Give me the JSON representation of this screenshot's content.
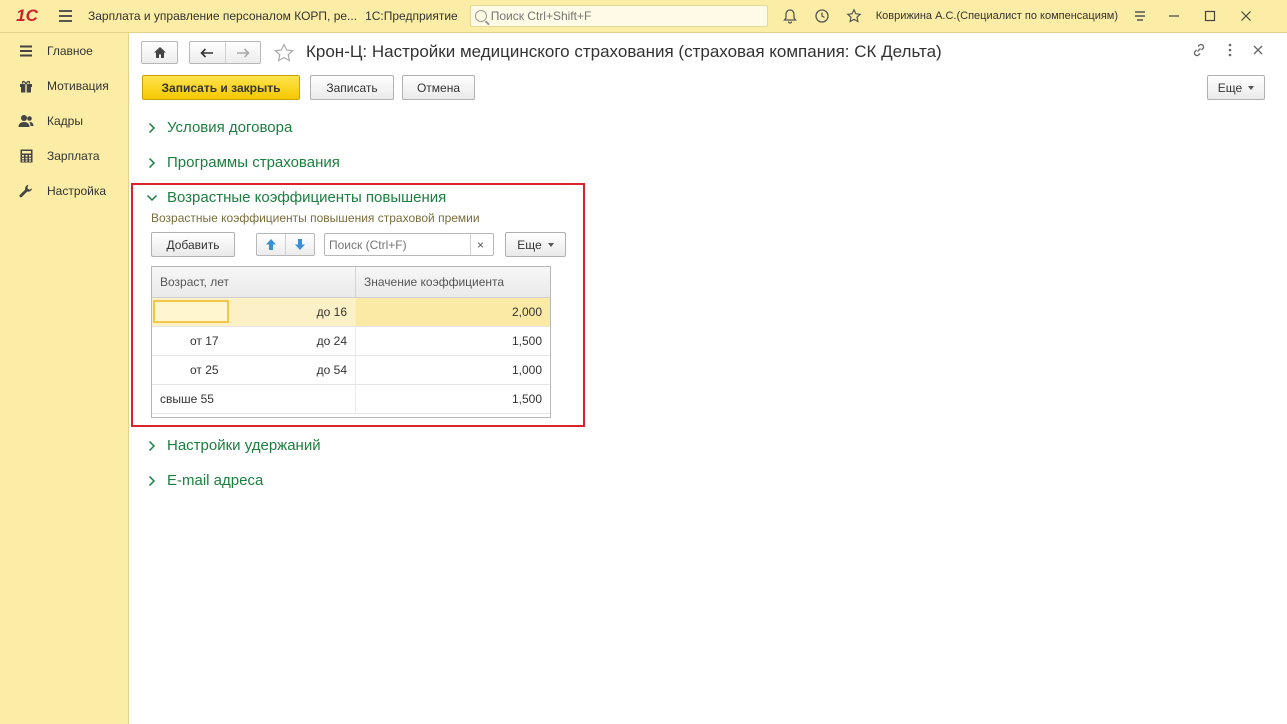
{
  "titlebar": {
    "logo": "1С",
    "app_title": "Зарплата и управление персоналом КОРП, ре...",
    "platform": "1С:Предприятие",
    "search_placeholder": "Поиск Ctrl+Shift+F",
    "user": "Коврижина А.С.(Специалист по компенсациям)"
  },
  "sidebar": {
    "items": [
      {
        "label": "Главное",
        "icon": "menu-lines-icon"
      },
      {
        "label": "Мотивация",
        "icon": "gift-icon"
      },
      {
        "label": "Кадры",
        "icon": "people-icon"
      },
      {
        "label": "Зарплата",
        "icon": "calculator-icon"
      },
      {
        "label": "Настройка",
        "icon": "wrench-icon"
      }
    ]
  },
  "document": {
    "title": "Крон-Ц: Настройки медицинского страхования (страховая компания: СК Дельта)"
  },
  "toolbar": {
    "save_close": "Записать и закрыть",
    "save": "Записать",
    "cancel": "Отмена",
    "more": "Еще"
  },
  "sections": {
    "contract": "Условия договора",
    "programs": "Программы страхования",
    "age_coef": "Возрастные коэффициенты повышения",
    "deductions": "Настройки удержаний",
    "email": "E-mail адреса"
  },
  "age_table": {
    "caption": "Возрастные коэффициенты повышения страховой премии",
    "add": "Добавить",
    "search_placeholder": "Поиск (Ctrl+F)",
    "clear": "×",
    "more": "Еще",
    "headers": {
      "age": "Возраст, лет",
      "value": "Значение коэффициента"
    },
    "rows": [
      {
        "from": "",
        "to": "до 16",
        "value": "2,000"
      },
      {
        "from": "от 17",
        "to": "до 24",
        "value": "1,500"
      },
      {
        "from": "от 25",
        "to": "до 54",
        "value": "1,000"
      },
      {
        "from": "свыше 55",
        "to": "",
        "value": "1,500"
      }
    ]
  },
  "colors": {
    "accent_green": "#1b7f3f",
    "panel_yellow": "#fbeda6",
    "primary_button": "#f5c800",
    "highlight_red": "#d9232d"
  }
}
